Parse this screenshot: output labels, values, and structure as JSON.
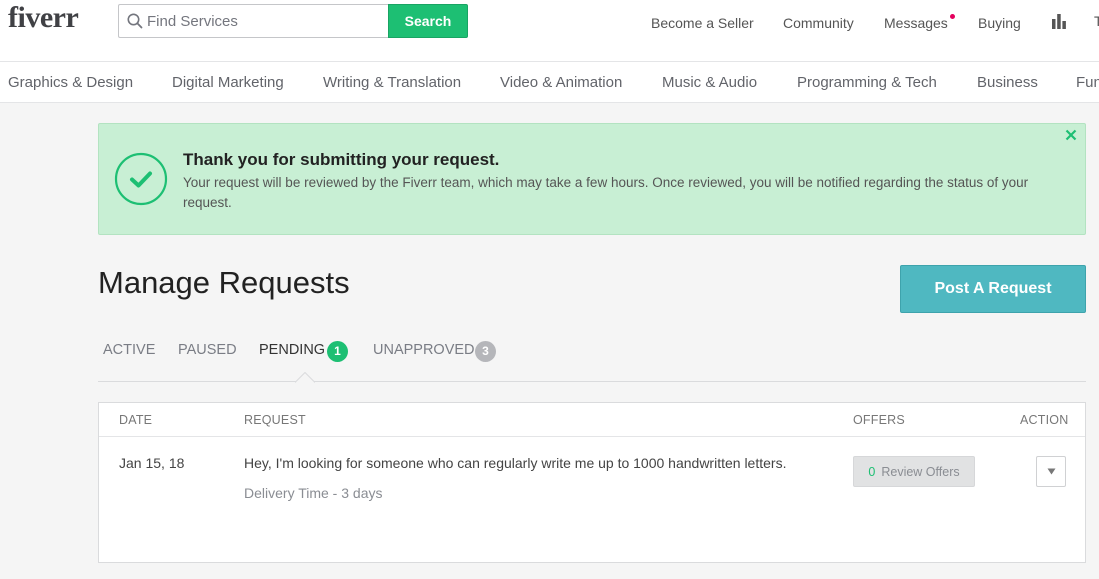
{
  "header": {
    "logo": "fiverr",
    "search_placeholder": "Find Services",
    "search_button": "Search",
    "nav": {
      "become_seller": "Become a Seller",
      "community": "Community",
      "messages": "Messages",
      "buying": "Buying",
      "cut_off": "T"
    },
    "icons": {
      "search": "search-icon",
      "stats": "bar-chart-icon",
      "notification": "notification-dot"
    }
  },
  "categories": [
    "Graphics & Design",
    "Digital Marketing",
    "Writing & Translation",
    "Video & Animation",
    "Music & Audio",
    "Programming & Tech",
    "Business",
    "Fun"
  ],
  "alert": {
    "title": "Thank you for submitting your request.",
    "body": "Your request will be reviewed by the Fiverr team, which may take a few hours. Once reviewed, you will be notified regarding the status of your request.",
    "icons": {
      "status": "check-circle-icon",
      "close": "close-icon"
    }
  },
  "page": {
    "title": "Manage Requests",
    "post_button": "Post A Request"
  },
  "tabs": {
    "active": "ACTIVE",
    "paused": "PAUSED",
    "pending": "PENDING",
    "pending_count": "1",
    "unapproved": "UNAPPROVED",
    "unapproved_count": "3"
  },
  "table": {
    "headers": {
      "date": "DATE",
      "request": "REQUEST",
      "offers": "OFFERS",
      "action": "ACTION"
    },
    "rows": [
      {
        "date": "Jan 15, 18",
        "request": "Hey, I'm looking for someone who can regularly write me up to 1000 handwritten letters.",
        "delivery": "Delivery Time - 3 days",
        "offers_count": "0",
        "offers_label": "Review Offers"
      }
    ]
  },
  "colors": {
    "brand_green": "#1dbf73",
    "alert_bg": "#c8efd4",
    "post_button": "#4fb8c1",
    "badge_grey": "#b5b6ba",
    "message_dot": "#e4005d"
  }
}
